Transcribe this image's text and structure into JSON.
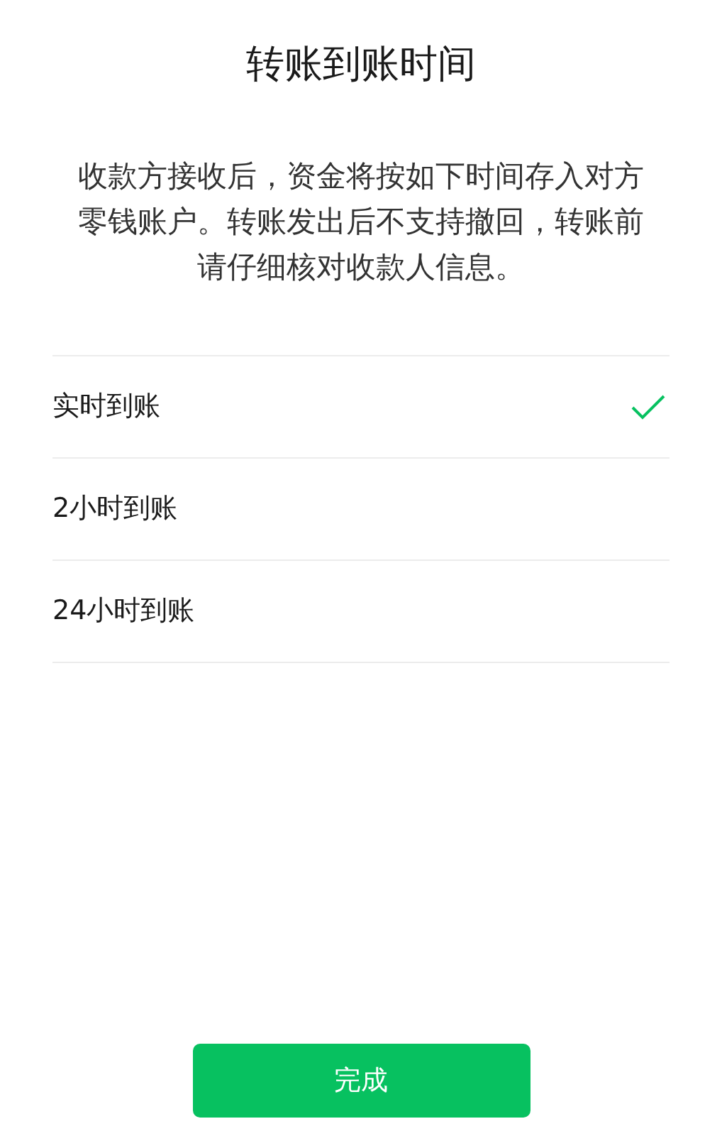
{
  "title": "转账到账时间",
  "description": "收款方接收后，资金将按如下时间存入对方零钱账户。转账发出后不支持撤回，转账前请仔细核对收款人信息。",
  "options": [
    {
      "label": "实时到账",
      "selected": true
    },
    {
      "label": "2小时到账",
      "selected": false
    },
    {
      "label": "24小时到账",
      "selected": false
    }
  ],
  "confirm_button": "完成"
}
